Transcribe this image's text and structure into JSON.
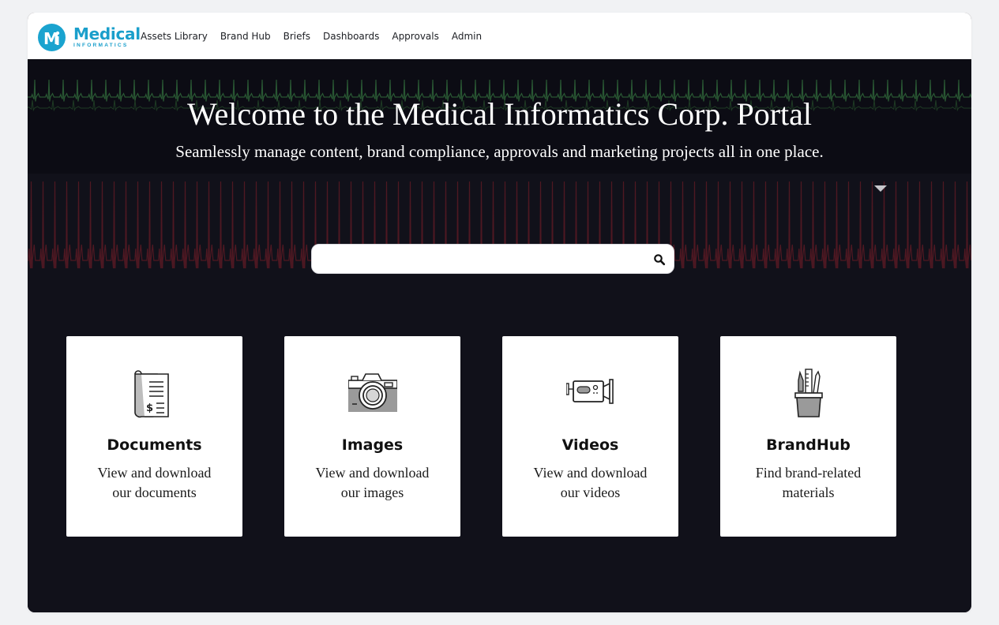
{
  "brand": {
    "logo_letter": "M",
    "name": "Medical",
    "tagline": "INFORMATICS",
    "color": "#1aa3cf"
  },
  "nav": {
    "links": [
      "Assets Library",
      "Brand Hub",
      "Briefs",
      "Dashboards",
      "Approvals",
      "Admin"
    ]
  },
  "hero": {
    "title": "Welcome to the Medical Informatics Corp. Portal",
    "subtitle": "Seamlessly manage content, brand compliance, approvals and marketing projects all in one place.",
    "background_color": "#11111a",
    "ecg_colors": {
      "top": "#2f6b3a",
      "bottom": "#6b1f2a"
    }
  },
  "search": {
    "value": "",
    "placeholder": "",
    "icon": "search-icon"
  },
  "cards": [
    {
      "title": "Documents",
      "desc_line1": "View and download",
      "desc_line2": "our documents",
      "icon": "document-receipt-icon"
    },
    {
      "title": "Images",
      "desc_line1": "View and download",
      "desc_line2": "our images",
      "icon": "camera-icon"
    },
    {
      "title": "Videos",
      "desc_line1": "View and download",
      "desc_line2": "our videos",
      "icon": "video-camera-icon"
    },
    {
      "title": "BrandHub",
      "desc_line1": "Find brand-related",
      "desc_line2": "materials",
      "icon": "pencil-cup-icon"
    }
  ]
}
